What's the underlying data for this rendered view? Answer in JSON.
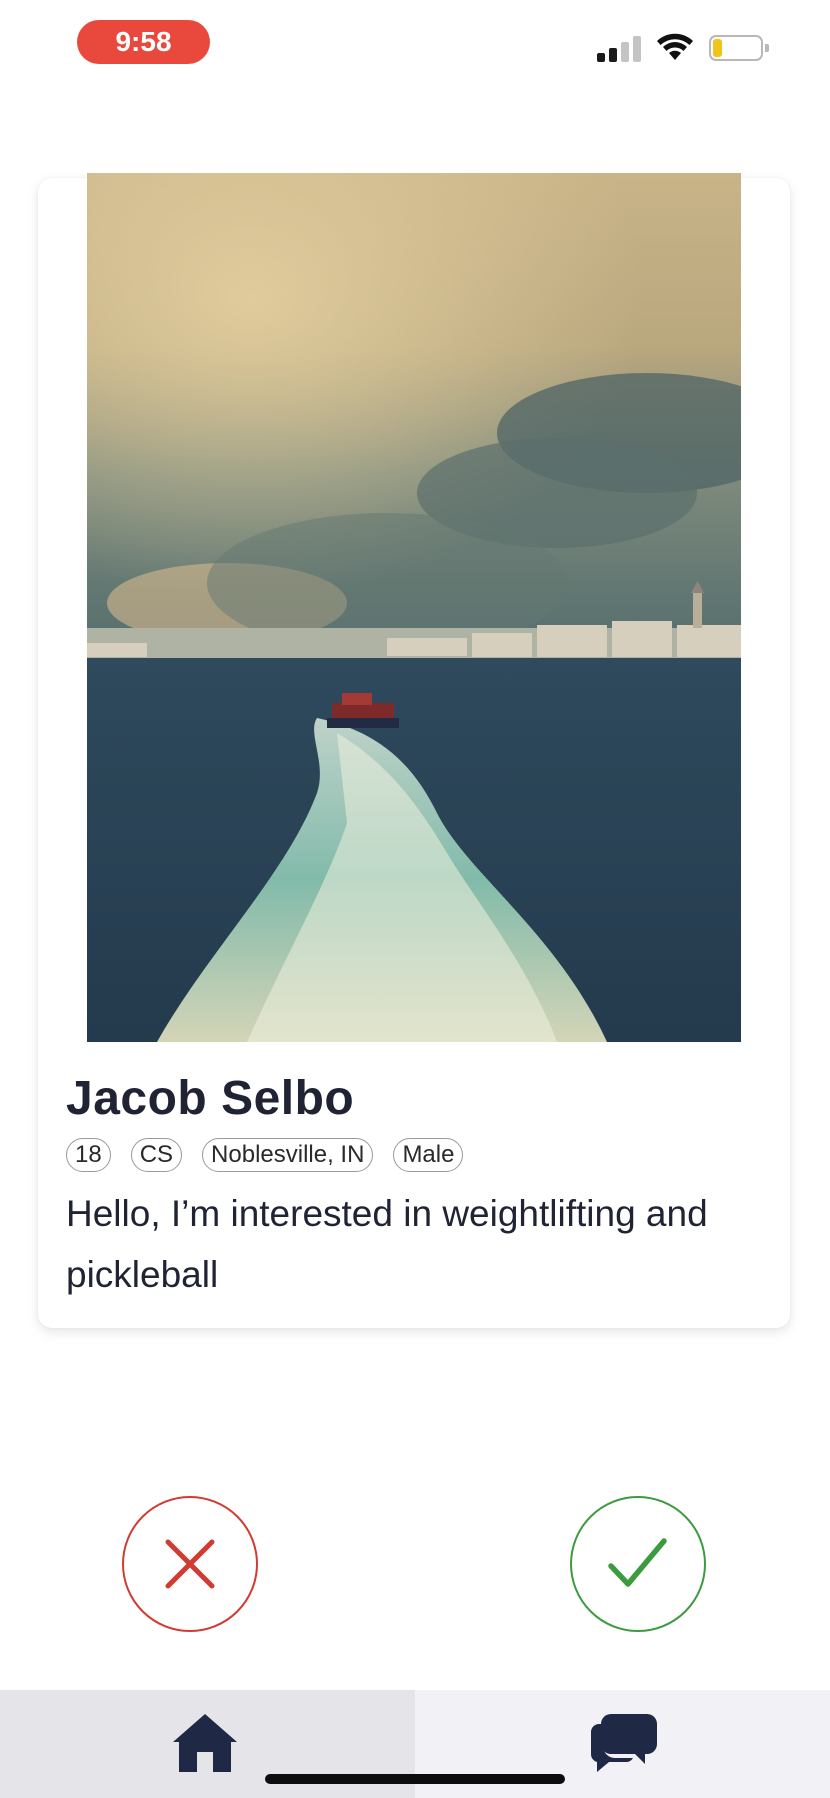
{
  "status_bar": {
    "time": "9:58",
    "time_pill_color": "#e8493c",
    "battery_level_color": "#f0c419"
  },
  "profile": {
    "photo_description_icon": "landscape-photo",
    "name": "Jacob Selbo",
    "tags": [
      "18",
      "CS",
      "Noblesville, IN",
      "Male"
    ],
    "bio": "Hello, I’m interested in weightlifting and pickleball"
  },
  "actions": {
    "reject_icon": "x-icon",
    "reject_color": "#d13b31",
    "accept_icon": "check-icon",
    "accept_color": "#3c9a3f"
  },
  "tab_bar": {
    "tabs": [
      {
        "icon": "home-icon",
        "selected": true
      },
      {
        "icon": "chat-bubbles-icon",
        "selected": false
      }
    ]
  }
}
